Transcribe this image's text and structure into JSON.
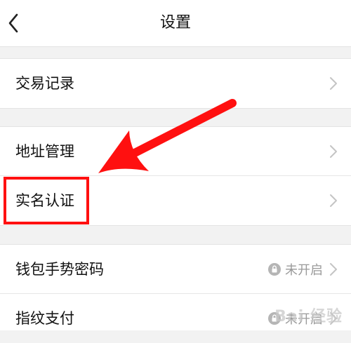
{
  "nav": {
    "title": "设置",
    "back_icon": "chevron-left-icon"
  },
  "menu": {
    "transactions": "交易记录",
    "address": "地址管理",
    "realname": "实名认证",
    "gesture": "钱包手势密码",
    "fingerprint": "指纹支付"
  },
  "status": {
    "gesture": "未开启",
    "fingerprint": "未开启"
  },
  "annotation": {
    "highlight_color": "#ff1010",
    "arrow_color": "#ff1010",
    "target": "实名认证"
  },
  "watermark": "Bai 经验"
}
